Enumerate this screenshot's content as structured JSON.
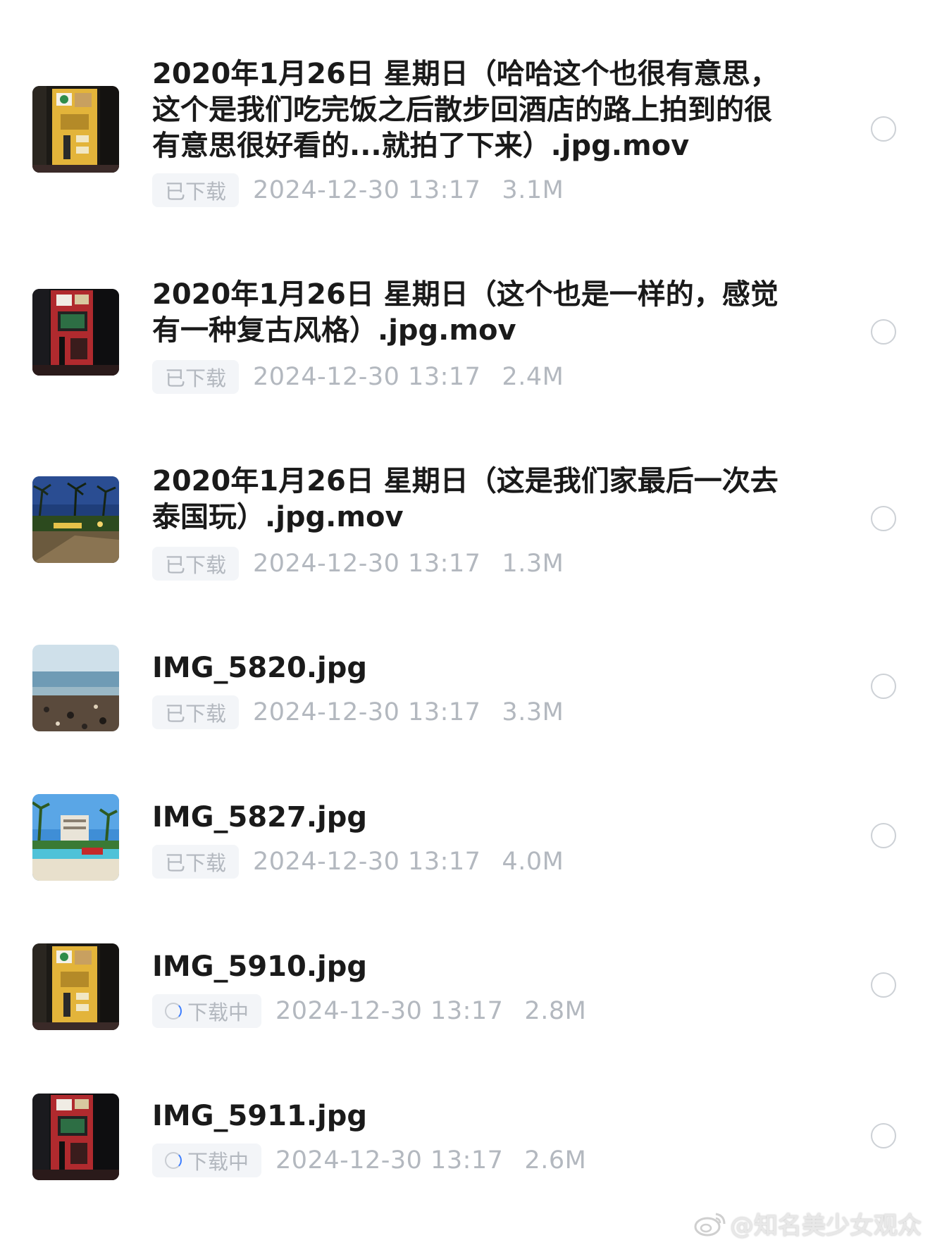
{
  "files": [
    {
      "name": "2020年1月26日 星期日（哈哈这个也很有意思，这个是我们吃完饭之后散步回酒店的路上拍到的很有意思很好看的...就拍了下来）.jpg.mov",
      "status": "已下载",
      "status_icon": "",
      "date": "2024-12-30 13:17",
      "size": "3.1M",
      "thumb_icon": "yellow-kiosk-thumbnail"
    },
    {
      "name": "2020年1月26日 星期日（这个也是一样的，感觉有一种复古风格）.jpg.mov",
      "status": "已下载",
      "status_icon": "",
      "date": "2024-12-30 13:17",
      "size": "2.4M",
      "thumb_icon": "red-kiosk-thumbnail"
    },
    {
      "name": "2020年1月26日 星期日（这是我们家最后一次去泰国玩）.jpg.mov",
      "status": "已下载",
      "status_icon": "",
      "date": "2024-12-30 13:17",
      "size": "1.3M",
      "thumb_icon": "night-palms-thumbnail"
    },
    {
      "name": "IMG_5820.jpg",
      "status": "已下载",
      "status_icon": "",
      "date": "2024-12-30 13:17",
      "size": "3.3M",
      "thumb_icon": "beach-thumbnail"
    },
    {
      "name": "IMG_5827.jpg",
      "status": "已下载",
      "status_icon": "",
      "date": "2024-12-30 13:17",
      "size": "4.0M",
      "thumb_icon": "resort-pool-thumbnail"
    },
    {
      "name": "IMG_5910.jpg",
      "status": "下载中",
      "status_icon": "spinner-icon",
      "date": "2024-12-30 13:17",
      "size": "2.8M",
      "thumb_icon": "yellow-kiosk-thumbnail"
    },
    {
      "name": "IMG_5911.jpg",
      "status": "下载中",
      "status_icon": "spinner-icon",
      "date": "2024-12-30 13:17",
      "size": "2.6M",
      "thumb_icon": "red-kiosk-thumbnail"
    }
  ],
  "watermark": {
    "text": "@知名美少女观众",
    "icon": "weibo-icon"
  },
  "colors": {
    "title": "#1a1a1a",
    "meta_text": "#b3b8bf",
    "badge_bg": "#f3f5f8",
    "spinner_accent": "#3d7eff",
    "radio_border": "#cdd1d6"
  }
}
